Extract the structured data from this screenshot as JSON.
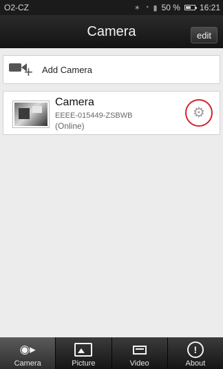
{
  "status_bar": {
    "carrier": "O2-CZ",
    "icons": [
      "bluetooth-icon",
      "wifi-icon",
      "signal-icon"
    ],
    "battery": "50 %",
    "time": "16:21"
  },
  "header": {
    "title": "Camera",
    "edit_label": "edit"
  },
  "add_camera": {
    "label": "Add Camera",
    "icon": "add-camera-icon"
  },
  "cameras": [
    {
      "name": "Camera",
      "id": "EEEE-015449-ZSBWB",
      "status": "(Online)",
      "settings_icon": "gear-icon"
    }
  ],
  "tabbar": {
    "tabs": [
      {
        "label": "Camera",
        "icon": "camera-tab-icon"
      },
      {
        "label": "Picture",
        "icon": "picture-icon"
      },
      {
        "label": "Video",
        "icon": "video-icon"
      },
      {
        "label": "About",
        "icon": "about-icon"
      }
    ]
  },
  "colors": {
    "highlight": "#d4232a",
    "header_bg": "#1b1b1b"
  }
}
